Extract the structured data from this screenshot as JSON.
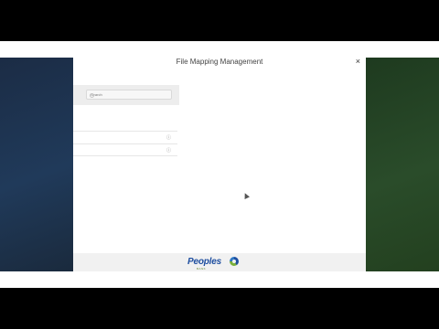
{
  "modal": {
    "title": "File Mapping Management",
    "close_glyph": "×"
  },
  "search": {
    "placeholder": "Search"
  },
  "list": {
    "items": [
      {
        "icon": "info-icon",
        "glyph": "ⓘ"
      },
      {
        "icon": "info-icon",
        "glyph": "ⓘ"
      }
    ]
  },
  "footer": {
    "logo_text": "Peoples",
    "logo_subtext": "BANK"
  },
  "colors": {
    "brand_blue": "#1f4fa0",
    "brand_green": "#7bb03a"
  }
}
